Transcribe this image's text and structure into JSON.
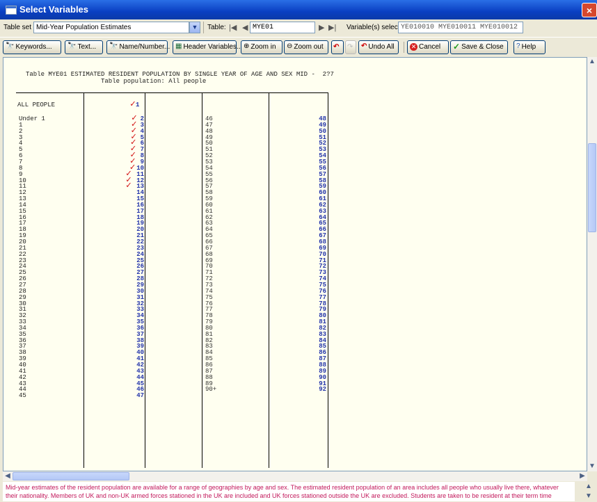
{
  "window": {
    "title": "Select Variables",
    "close_glyph": "×"
  },
  "toolbar_row1": {
    "table_set_label": "Table set",
    "table_set_value": "Mid-Year Population Estimates",
    "table_label": "Table:",
    "table_value": "MYE01",
    "variables_label": "Variable(s) selected",
    "variables_value": "YE010010 MYE010011 MYE010012"
  },
  "toolbar_row2": {
    "keywords": "Keywords...",
    "text": "Text...",
    "name_number": "Name/Number...",
    "header_variables": "Header Variables...",
    "zoom_in": "Zoom in",
    "zoom_out": "Zoom out",
    "undo_all": "Undo All",
    "cancel": "Cancel",
    "save_close": "Save & Close",
    "help": "Help"
  },
  "document": {
    "title_line": "Table MYE01 ESTIMATED RESIDENT POPULATION BY SINGLE YEAR OF AGE AND SEX MID -  2?7",
    "subtitle_line": "Table population: All people",
    "row_header": "ALL PEOPLE",
    "first_value": "1",
    "left_labels": [
      "Under 1",
      "1",
      "2",
      "3",
      "4",
      "5",
      "6",
      "7",
      "8",
      "9",
      "10",
      "11",
      "12",
      "13",
      "14",
      "15",
      "16",
      "17",
      "18",
      "19",
      "20",
      "21",
      "22",
      "23",
      "24",
      "25",
      "26",
      "27",
      "28",
      "29",
      "30",
      "31",
      "32",
      "33",
      "34",
      "35",
      "36",
      "37",
      "38",
      "39",
      "40",
      "41",
      "42",
      "43",
      "44",
      "45"
    ],
    "left_values": [
      "2",
      "3",
      "4",
      "5",
      "6",
      "7",
      "8",
      "9",
      "10",
      "11",
      "12",
      "13",
      "14",
      "15",
      "16",
      "17",
      "18",
      "19",
      "20",
      "21",
      "22",
      "23",
      "24",
      "25",
      "26",
      "27",
      "28",
      "29",
      "30",
      "31",
      "32",
      "33",
      "34",
      "35",
      "36",
      "37",
      "38",
      "39",
      "40",
      "41",
      "42",
      "43",
      "44",
      "45",
      "46",
      "47"
    ],
    "right_labels": [
      "46",
      "47",
      "48",
      "49",
      "50",
      "51",
      "52",
      "53",
      "54",
      "55",
      "56",
      "57",
      "58",
      "59",
      "60",
      "61",
      "62",
      "63",
      "64",
      "65",
      "66",
      "67",
      "68",
      "69",
      "70",
      "71",
      "72",
      "73",
      "74",
      "75",
      "76",
      "77",
      "78",
      "79",
      "80",
      "81",
      "82",
      "83",
      "84",
      "85",
      "86",
      "87",
      "88",
      "89",
      "90+"
    ],
    "right_values": [
      "48",
      "49",
      "50",
      "51",
      "52",
      "53",
      "54",
      "55",
      "56",
      "57",
      "58",
      "59",
      "60",
      "61",
      "62",
      "63",
      "64",
      "65",
      "66",
      "67",
      "68",
      "69",
      "70",
      "71",
      "72",
      "73",
      "74",
      "75",
      "76",
      "77",
      "78",
      "79",
      "80",
      "81",
      "82",
      "83",
      "84",
      "85",
      "86",
      "87",
      "88",
      "89",
      "90",
      "91",
      "92"
    ],
    "checked_count": 13
  },
  "description": "Mid-year estimates of the resident population are available for a range of geographies by age and sex. The estimated resident population of an area includes all people who usually live there, whatever their nationality. Members of UK and non-UK armed forces stationed in the UK are included and UK forces stationed outside the UK are excluded. Students are taken to be resident at their term time"
}
